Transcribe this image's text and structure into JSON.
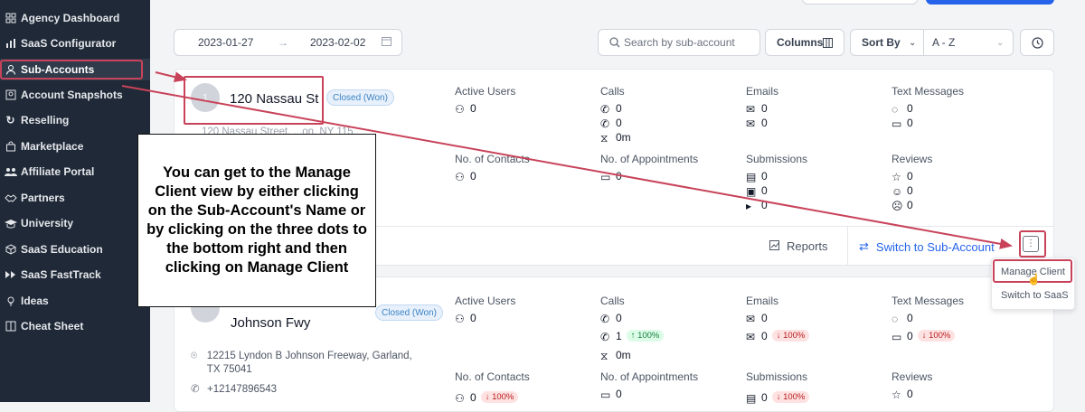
{
  "sidebar": {
    "items": [
      {
        "label": "Agency Dashboard",
        "icon": "dashboard-icon"
      },
      {
        "label": "SaaS Configurator",
        "icon": "bar-chart-icon"
      },
      {
        "label": "Sub-Accounts",
        "icon": "user-icon"
      },
      {
        "label": "Account Snapshots",
        "icon": "snapshot-icon"
      },
      {
        "label": "Reselling",
        "icon": "refresh-icon"
      },
      {
        "label": "Marketplace",
        "icon": "shopping-bag-icon"
      },
      {
        "label": "Affiliate Portal",
        "icon": "users-icon"
      },
      {
        "label": "Partners",
        "icon": "handshake-icon"
      },
      {
        "label": "University",
        "icon": "graduation-cap-icon"
      },
      {
        "label": "SaaS Education",
        "icon": "box-icon"
      },
      {
        "label": "SaaS FastTrack",
        "icon": "fast-forward-icon"
      },
      {
        "label": "Ideas",
        "icon": "lightbulb-icon"
      },
      {
        "label": "Cheat Sheet",
        "icon": "columns-icon"
      }
    ]
  },
  "toolbar": {
    "date_start": "2023-01-27",
    "date_end": "2023-02-02",
    "search_placeholder": "Search by sub-account",
    "columns_label": "Columns",
    "sort_by_label": "Sort By",
    "sort_value": "A - Z"
  },
  "labels": {
    "active_users": "Active Users",
    "calls": "Calls",
    "emails": "Emails",
    "text_messages": "Text Messages",
    "no_contacts": "No. of Contacts",
    "no_appointments": "No. of Appointments",
    "submissions": "Submissions",
    "reviews": "Reviews"
  },
  "card1": {
    "avatar": "1",
    "name": "120 Nassau St",
    "status": "Closed (Won)",
    "address_partial": "120 Nassau Street, ...on, NY 115..",
    "active_users": "0",
    "calls": [
      "0",
      "0",
      "0m"
    ],
    "emails": [
      "0",
      "0"
    ],
    "texts": [
      "0",
      "0"
    ],
    "contacts": "0",
    "appointments": "0",
    "submissions": [
      "0",
      "0",
      "0"
    ],
    "reviews": [
      "0",
      "0",
      "0"
    ],
    "reports_label": "Reports",
    "switch_label": "Switch to Sub-Account"
  },
  "card2": {
    "name_line2": "Johnson Fwy",
    "status": "Closed (Won)",
    "address": "12215 Lyndon B Johnson Freeway, Garland, TX 75041",
    "phone": "+12147896543",
    "active_users": "0",
    "calls": [
      "0",
      "1",
      "0m"
    ],
    "calls_change": "100%",
    "emails": [
      "0",
      "0"
    ],
    "emails_change": "100%",
    "texts": [
      "0",
      "0"
    ],
    "texts_change": "100%",
    "contacts": "0",
    "contacts_change": "100%",
    "appointments": "0",
    "submissions": "0",
    "submissions_change": "100%",
    "reviews": "0"
  },
  "menu": {
    "manage_client": "Manage Client",
    "switch_saas": "Switch to SaaS"
  },
  "callout_text": "You can get to the Manage Client view by either clicking on the Sub-Account's Name or by clicking on the three dots to the bottom right and then clicking on Manage Client",
  "colors": {
    "sidebar_bg": "#1f2937",
    "highlight": "#c8435a",
    "primary": "#2563eb",
    "badge": "#3b82c4"
  }
}
